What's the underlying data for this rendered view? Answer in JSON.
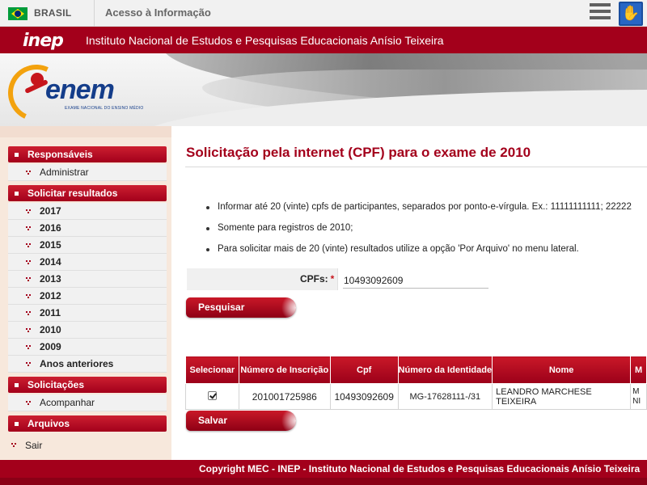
{
  "govbar": {
    "country": "BRASIL",
    "link": "Acesso à Informação",
    "menu_icon": "hamburger-icon",
    "accessibility_icon": "libras-hand-icon"
  },
  "inepbar": {
    "logo": "inep",
    "name": "Instituto Nacional de Estudos e Pesquisas Educacionais Anísio Teixeira"
  },
  "banner": {
    "logo_text": "enem",
    "logo_subtitle": "EXAME NACIONAL DO ENSINO MÉDIO"
  },
  "sidebar": {
    "sections": [
      {
        "title": "Responsáveis",
        "items": [
          "Administrar"
        ]
      },
      {
        "title": "Solicitar resultados",
        "items": [
          "2017",
          "2016",
          "2015",
          "2014",
          "2013",
          "2012",
          "2011",
          "2010",
          "2009",
          "Anos anteriores"
        ]
      },
      {
        "title": "Solicitações",
        "items": [
          "Acompanhar"
        ]
      },
      {
        "title": "Arquivos",
        "items": []
      }
    ],
    "sair": "Sair"
  },
  "main": {
    "title": "Solicitação pela internet (CPF) para o exame de 2010",
    "info": [
      "Informar até 20 (vinte) cpfs de participantes, separados por ponto-e-vírgula. Ex.: 11111111111; 22222",
      "Somente para registros de 2010;",
      "Para solicitar mais de 20 (vinte) resultados utilize a opção 'Por Arquivo' no menu lateral."
    ],
    "cpf_label": "CPFs:",
    "cpf_required": "*",
    "cpf_value": "10493092609",
    "search_button": "Pesquisar",
    "save_button": "Salvar"
  },
  "table": {
    "headers": [
      "Selecionar",
      "Número de Inscrição",
      "Cpf",
      "Número da Identidade",
      "Nome",
      "M"
    ],
    "rows": [
      {
        "selected": true,
        "inscricao": "201001725986",
        "cpf": "10493092609",
        "identidade": "MG-17628111-/31",
        "nome": "LEANDRO MARCHESE TEIXEIRA",
        "extra": "M NI"
      }
    ]
  },
  "footer": {
    "copyright": "Copyright MEC - INEP - Instituto Nacional de Estudos e Pesquisas Educacionais Anísio Teixeira"
  },
  "colors": {
    "brand_red": "#a3001b",
    "sidebar_bg": "#f7e8dc"
  }
}
